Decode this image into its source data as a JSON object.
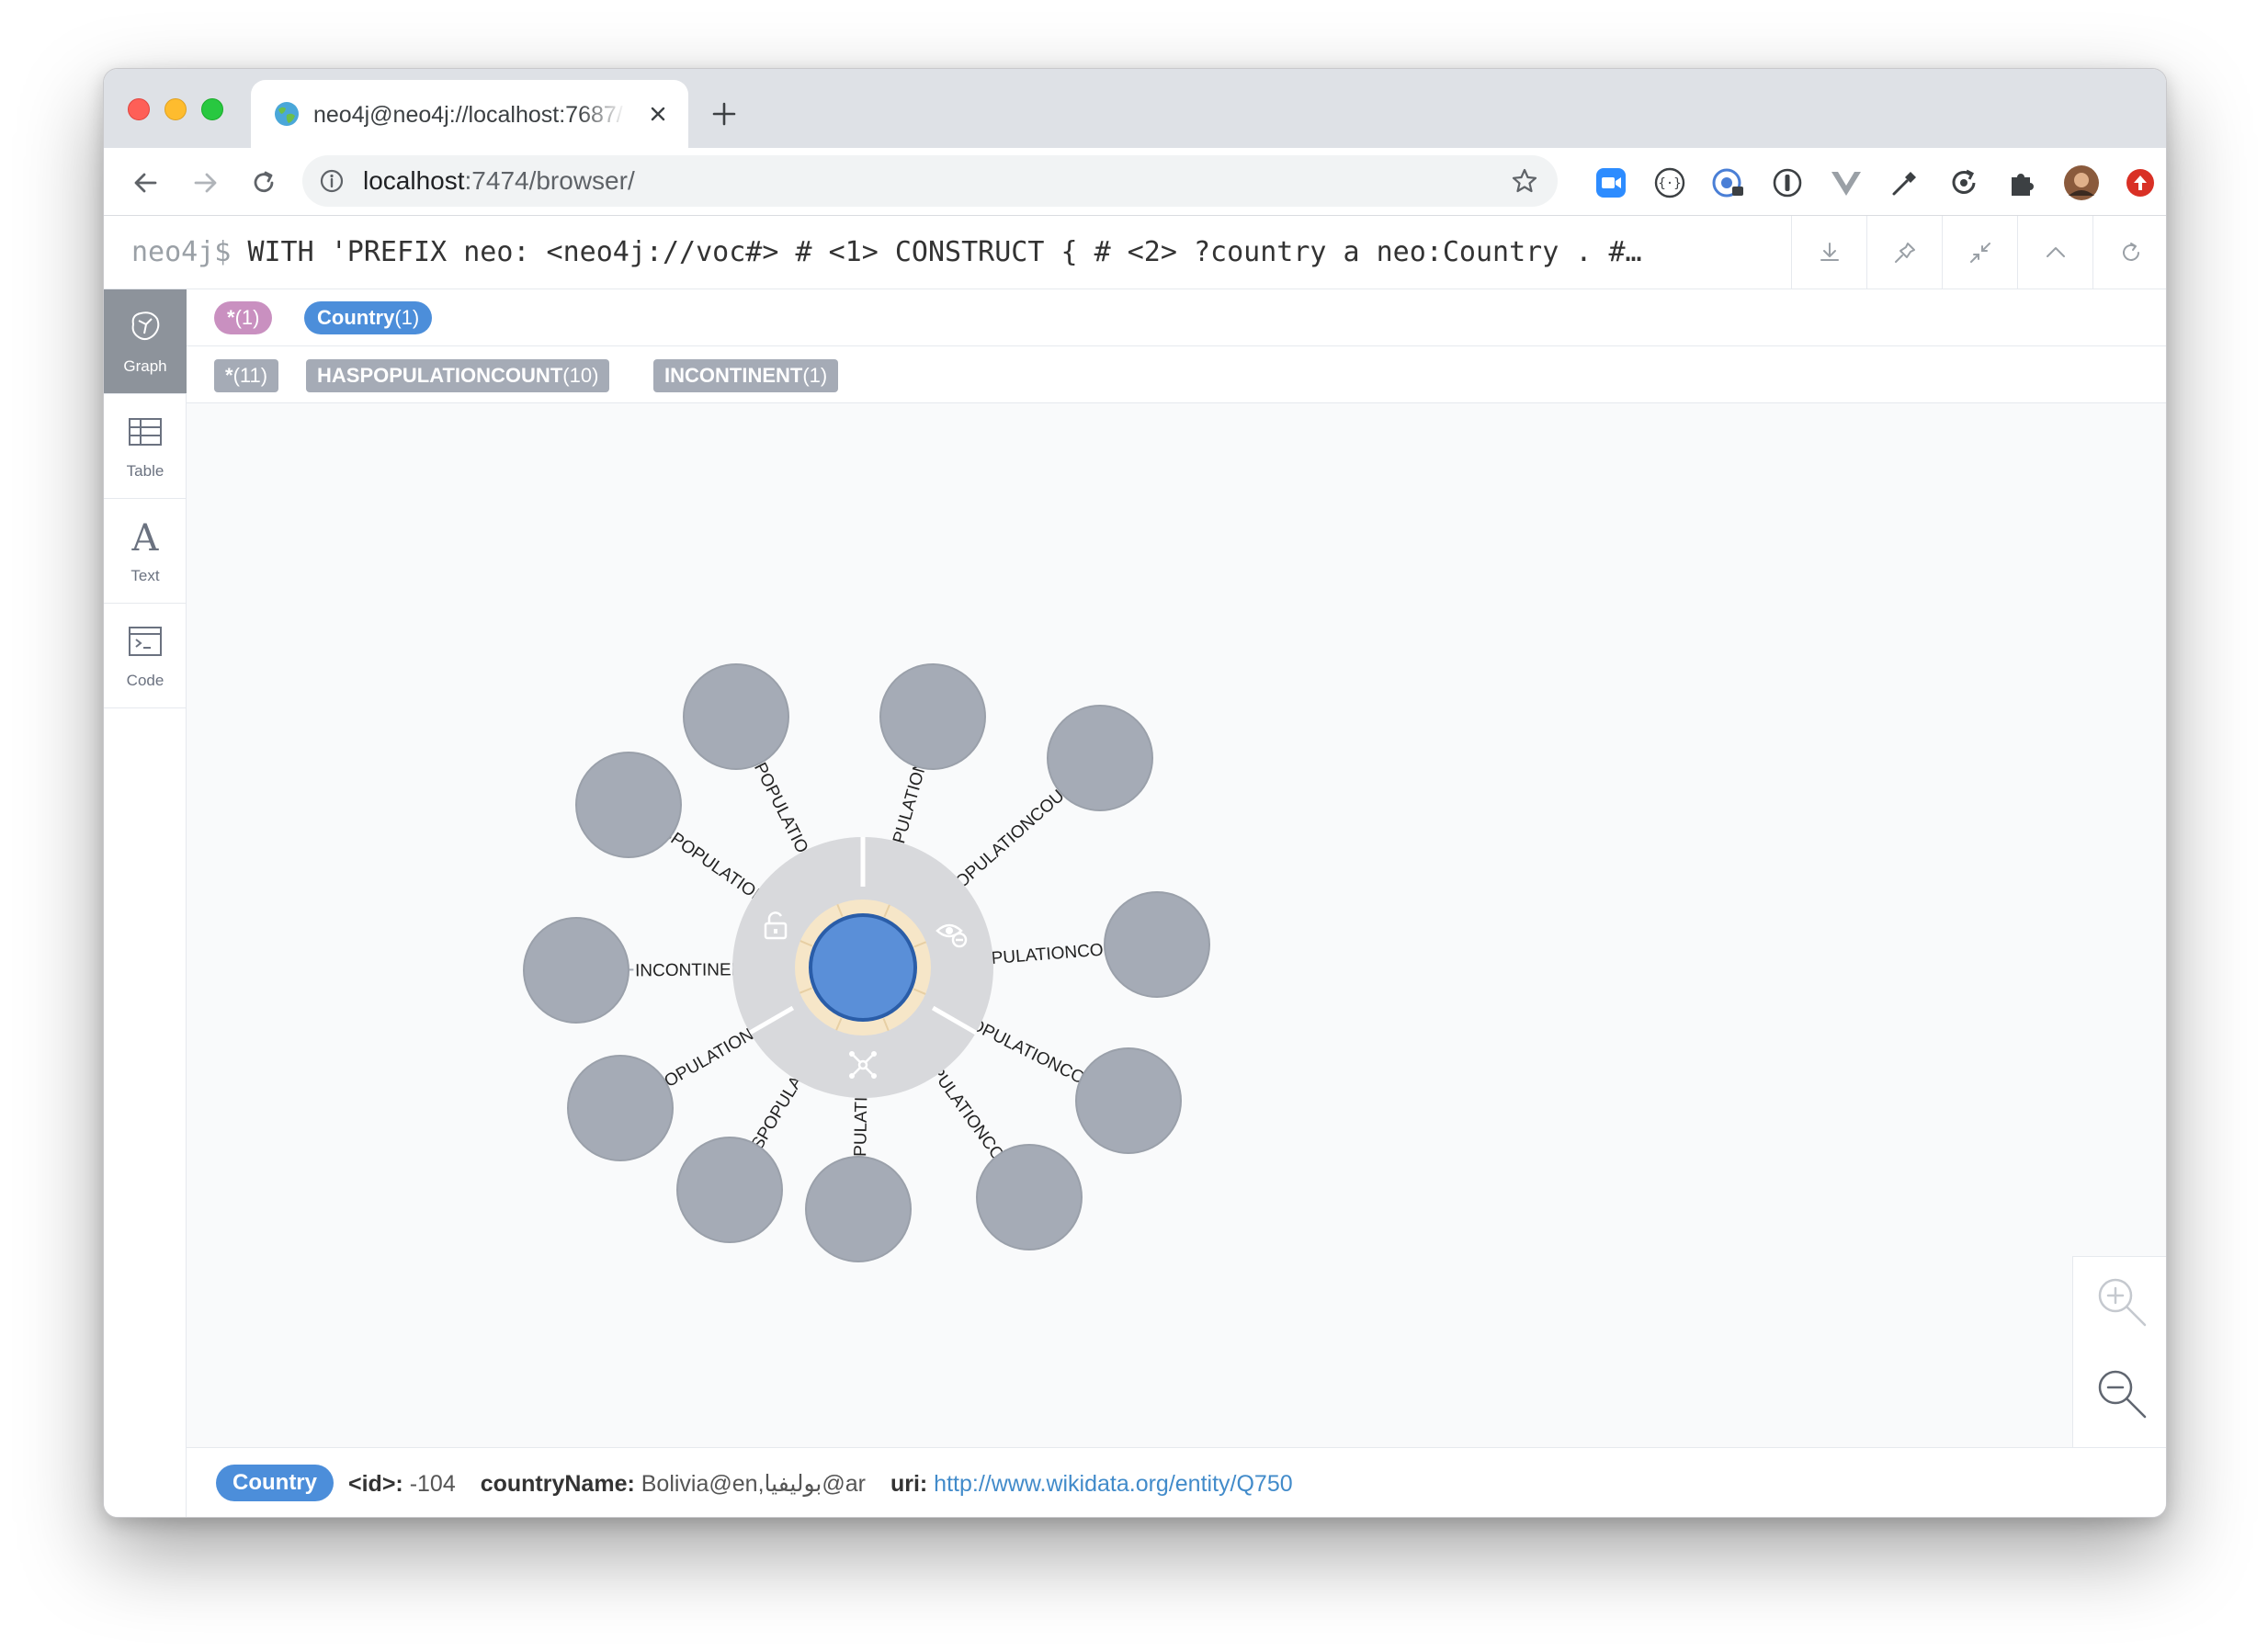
{
  "browser": {
    "tab_title": "neo4j@neo4j://localhost:7687/",
    "url_host": "localhost",
    "url_path": ":7474/browser/"
  },
  "editor": {
    "prompt": "neo4j$",
    "query": "WITH 'PREFIX neo: <neo4j://voc#> # <1> CONSTRUCT { # <2> ?country a neo:Country . #…"
  },
  "left_nav": {
    "items": [
      {
        "label": "Graph",
        "icon": "graph-icon",
        "active": true
      },
      {
        "label": "Table",
        "icon": "table-icon",
        "active": false
      },
      {
        "label": "Text",
        "icon": "text-icon",
        "active": false
      },
      {
        "label": "Code",
        "icon": "code-icon",
        "active": false
      }
    ]
  },
  "legend": {
    "node_labels": [
      {
        "name": "*",
        "count": "(1)",
        "color": "#c990c0"
      },
      {
        "name": "Country",
        "count": "(1)",
        "color": "#4c8eda"
      }
    ],
    "relationship_types": [
      {
        "name": "*",
        "count": "(11)"
      },
      {
        "name": "HASPOPULATIONCOUNT",
        "count": "(10)"
      },
      {
        "name": "INCONTINENT",
        "count": "(1)"
      }
    ]
  },
  "graph": {
    "center_node_color": "#5a8fd8",
    "outer_node_color": "#a5abb6",
    "edge_labels": [
      "HASPOPULATIONCOUN",
      "HASPOPULATIONCOUN",
      "HASPOPULATIONCOUNT",
      "HASPOPULATIONCOUNT",
      "HASPOPULATIONCOUNT",
      "HASPOPULATIONCOUN",
      "HASPOPULATIONCOUNT",
      "HASPOPULATIONCO",
      "HASPOPULATIONC",
      "ASPOPULATIONCOUNT",
      "INCONTINENT"
    ]
  },
  "status": {
    "label": "Country",
    "id_key": "<id>:",
    "id_value": "-104",
    "name_key": "countryName:",
    "name_value": "Bolivia@en,بوليفيا@ar",
    "uri_key": "uri:",
    "uri_value": "http://www.wikidata.org/entity/Q750"
  }
}
